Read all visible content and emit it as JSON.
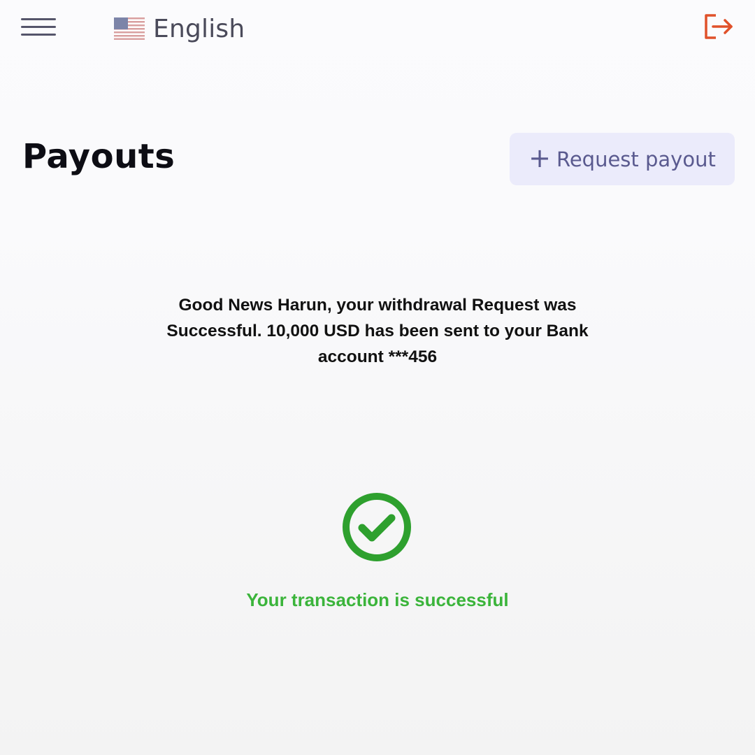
{
  "header": {
    "language": "English",
    "language_flag_icon": "us-flag-icon",
    "menu_icon": "hamburger-menu-icon",
    "logout_icon": "logout-icon",
    "logout_color": "#e0512a"
  },
  "page": {
    "title": "Payouts",
    "request_payout_label": "Request payout",
    "request_payout_icon": "plus-icon"
  },
  "message": {
    "text": "Good News Harun, your withdrawal Request was Successful. 10,000 USD has been sent to your Bank account ***456"
  },
  "status": {
    "icon": "check-circle-icon",
    "text": "Your transaction is successful",
    "color": "#3bb43b",
    "icon_color": "#2ea02e"
  }
}
